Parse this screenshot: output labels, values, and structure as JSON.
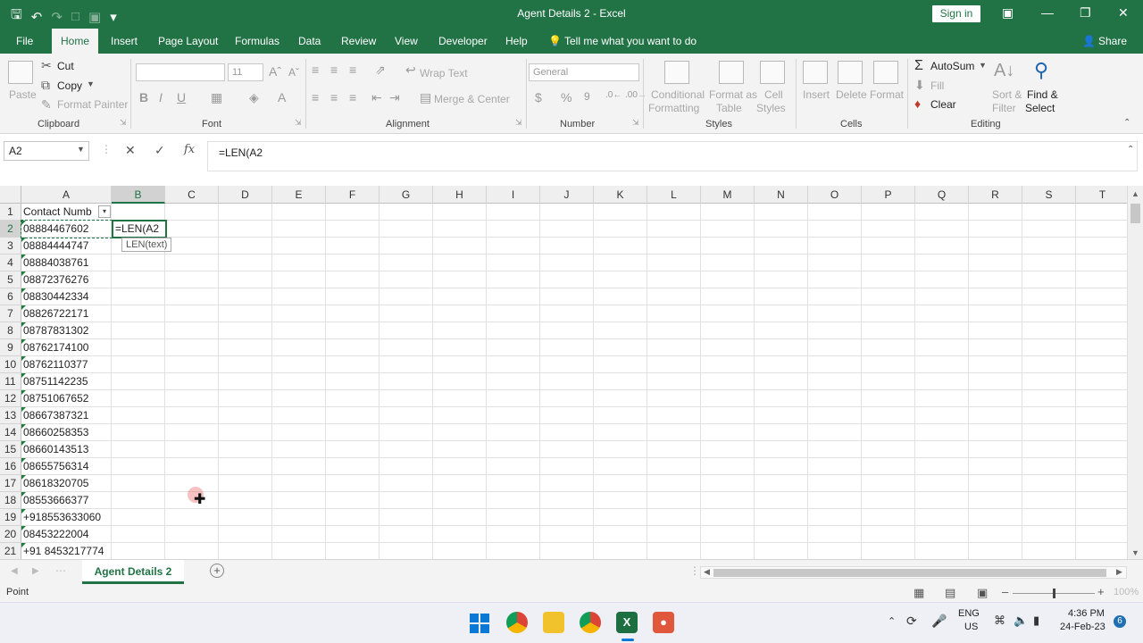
{
  "window": {
    "title": "Agent Details 2  -  Excel",
    "sign_in": "Sign in",
    "share": "Share"
  },
  "menu": {
    "tabs": [
      "File",
      "Home",
      "Insert",
      "Page Layout",
      "Formulas",
      "Data",
      "Review",
      "View",
      "Developer",
      "Help"
    ],
    "tell_me": "Tell me what you want to do"
  },
  "ribbon": {
    "clipboard": {
      "paste": "Paste",
      "cut": "Cut",
      "copy": "Copy",
      "format_painter": "Format Painter",
      "label": "Clipboard"
    },
    "font": {
      "size": "11",
      "label": "Font"
    },
    "alignment": {
      "wrap": "Wrap Text",
      "merge": "Merge & Center",
      "label": "Alignment"
    },
    "number": {
      "format": "General",
      "label": "Number"
    },
    "styles": {
      "conditional": "Conditional",
      "formatting": "Formatting",
      "format_as": "Format as",
      "table": "Table",
      "cell": "Cell",
      "cell_styles": "Styles",
      "label": "Styles"
    },
    "cells": {
      "insert": "Insert",
      "delete": "Delete",
      "format": "Format",
      "label": "Cells"
    },
    "editing": {
      "autosum": "AutoSum",
      "fill": "Fill",
      "clear": "Clear",
      "sort": "Sort &",
      "filter": "Filter",
      "find": "Find &",
      "select": "Select",
      "label": "Editing"
    }
  },
  "formula_bar": {
    "name_box": "A2",
    "content": "=LEN(A2"
  },
  "grid": {
    "columns": [
      "A",
      "B",
      "C",
      "D",
      "E",
      "F",
      "G",
      "H",
      "I",
      "J",
      "K",
      "L",
      "M",
      "N",
      "O",
      "P",
      "Q",
      "R",
      "S",
      "T"
    ],
    "rows": [
      "1",
      "2",
      "3",
      "4",
      "5",
      "6",
      "7",
      "8",
      "9",
      "10",
      "11",
      "12",
      "13",
      "14",
      "15",
      "16",
      "17",
      "18",
      "19",
      "20",
      "21"
    ],
    "column_a": [
      "Contact Numb",
      "08884467602",
      "08884444747",
      "08884038761",
      "08872376276",
      "08830442334",
      "08826722171",
      "08787831302",
      "08762174100",
      "08762110377",
      "08751142235",
      "08751067652",
      "08667387321",
      "08660258353",
      "08660143513",
      "08655756314",
      "08618320705",
      "08553666377",
      "+918553633060",
      "08453222004",
      "+91 8453217774"
    ],
    "active_cell_text": "=LEN(A2",
    "tooltip": "LEN(text)"
  },
  "sheets": {
    "active": "Agent Details 2"
  },
  "status": {
    "mode": "Point",
    "zoom": "100%"
  },
  "taskbar": {
    "lang": "ENG",
    "region": "US",
    "time": "4:36 PM",
    "date": "24-Feb-23",
    "badge": "6"
  }
}
